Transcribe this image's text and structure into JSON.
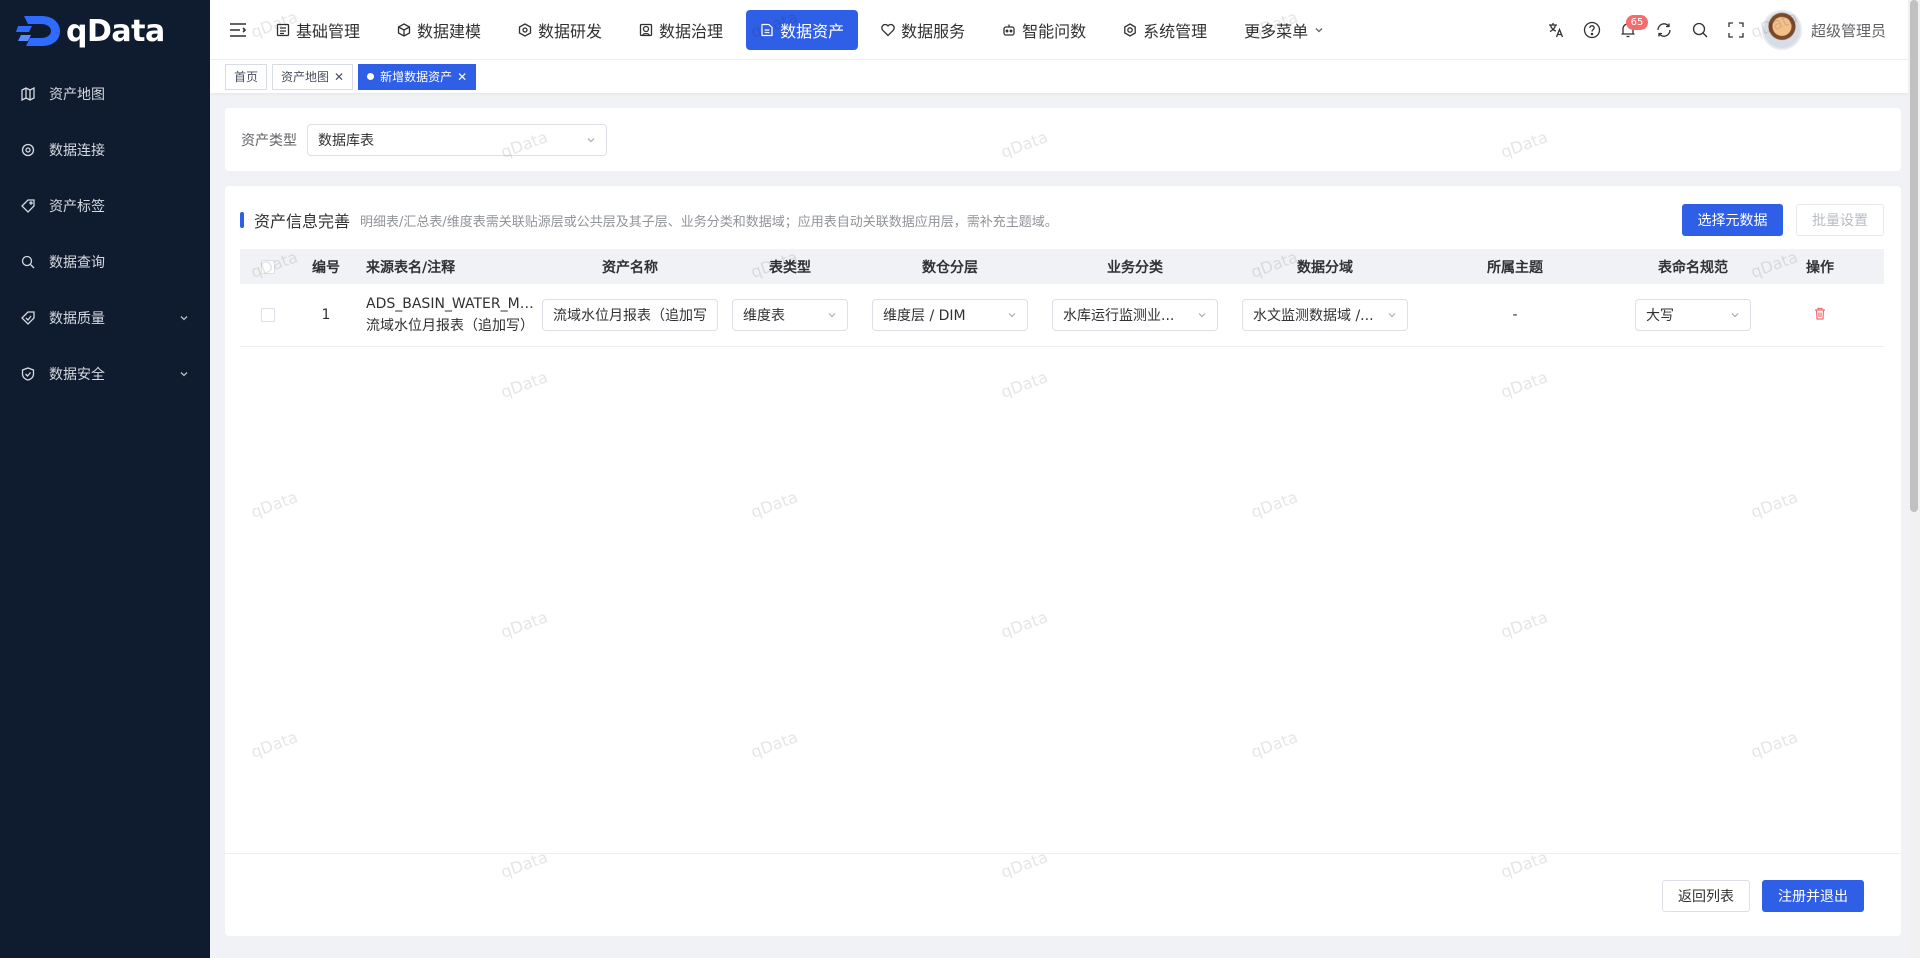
{
  "app": {
    "name": "qData"
  },
  "sidebar": {
    "items": [
      {
        "label": "资产地图",
        "icon": "map-icon",
        "has_arrow": false
      },
      {
        "label": "数据连接",
        "icon": "connection-icon",
        "has_arrow": false
      },
      {
        "label": "资产标签",
        "icon": "tag-icon",
        "has_arrow": false
      },
      {
        "label": "数据查询",
        "icon": "query-icon",
        "has_arrow": false
      },
      {
        "label": "数据质量",
        "icon": "quality-icon",
        "has_arrow": true
      },
      {
        "label": "数据安全",
        "icon": "security-icon",
        "has_arrow": true
      }
    ]
  },
  "topnav": {
    "items": [
      {
        "label": "基础管理",
        "icon": "grid-icon"
      },
      {
        "label": "数据建模",
        "icon": "cube-icon"
      },
      {
        "label": "数据研发",
        "icon": "hexagon-icon"
      },
      {
        "label": "数据治理",
        "icon": "govern-icon"
      },
      {
        "label": "数据资产",
        "icon": "asset-icon",
        "active": true
      },
      {
        "label": "数据服务",
        "icon": "service-icon"
      },
      {
        "label": "智能问数",
        "icon": "robot-icon"
      },
      {
        "label": "系统管理",
        "icon": "gear-icon"
      },
      {
        "label": "更多菜单",
        "icon": "",
        "has_chevron": true
      }
    ],
    "notification_count": "65",
    "user_name": "超级管理员"
  },
  "tabs": [
    {
      "label": "首页",
      "closable": false,
      "active": false
    },
    {
      "label": "资产地图",
      "closable": true,
      "active": false
    },
    {
      "label": "新增数据资产",
      "closable": true,
      "active": true
    }
  ],
  "asset_type": {
    "label": "资产类型",
    "value": "数据库表"
  },
  "section": {
    "title": "资产信息完善",
    "description": "明细表/汇总表/维度表需关联贴源层或公共层及其子层、业务分类和数据域；应用表自动关联数据应用层，需补充主题域。",
    "select_metadata_button": "选择元数据",
    "batch_settings_button": "批量设置"
  },
  "table": {
    "columns": [
      "编号",
      "来源表名/注释",
      "资产名称",
      "表类型",
      "数仓分层",
      "业务分类",
      "数据分域",
      "所属主题",
      "表命名规范",
      "操作"
    ],
    "rows": [
      {
        "no": "1",
        "source_table": "ADS_BASIN_WATER_MONTHLY",
        "source_display": "ADS_BASIN_WATER_MO...",
        "source_comment": "流域水位月报表（追加写）",
        "asset_name": "流域水位月报表（追加写",
        "table_type": "维度表",
        "layer": "维度层 / DIM",
        "business_category": "水库运行监测业...",
        "data_domain": "水文监测数据域 /...",
        "topic": "-",
        "naming_rule": "大写"
      }
    ]
  },
  "footer": {
    "back_button": "返回列表",
    "register_button": "注册并退出"
  },
  "watermark": "qData",
  "colors": {
    "primary": "#2f5fe6",
    "sidebar_bg": "#0f1b2e",
    "danger": "#f56c6c"
  }
}
